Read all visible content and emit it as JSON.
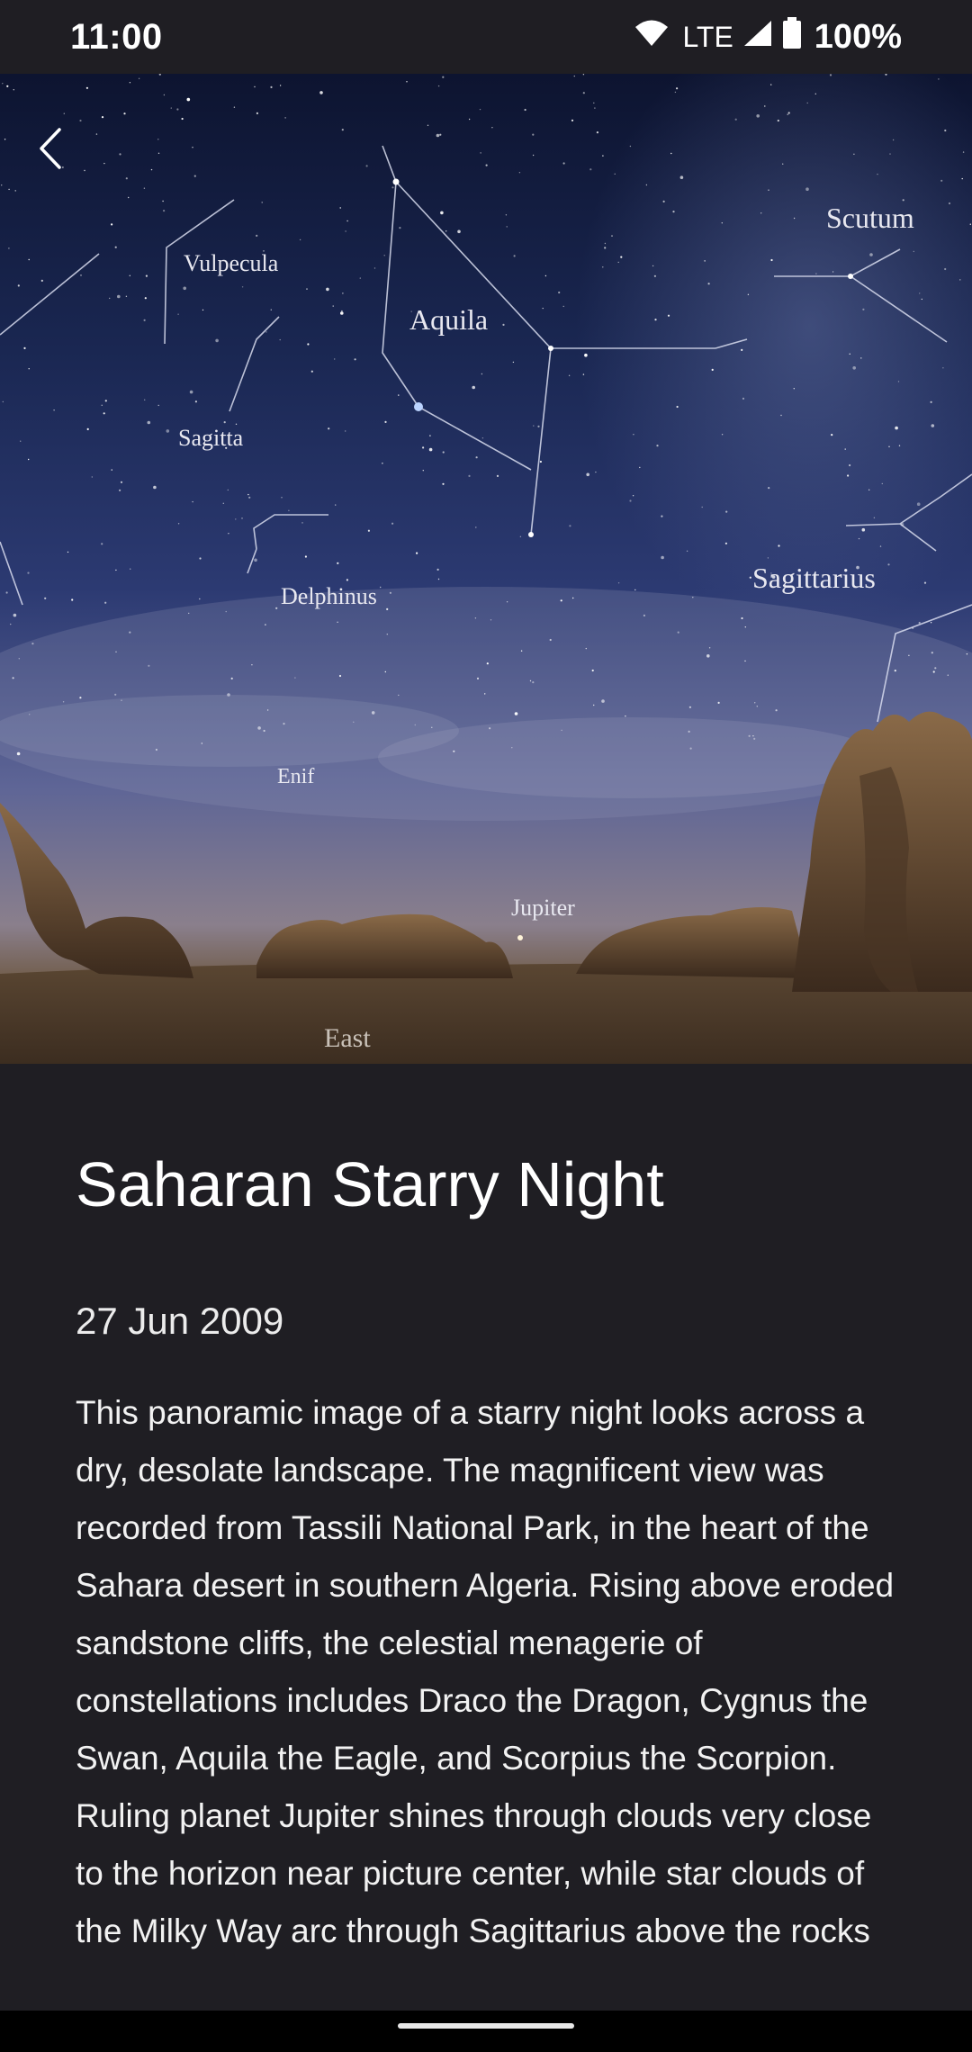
{
  "status_bar": {
    "time": "11:00",
    "network": "LTE",
    "battery": "100%"
  },
  "hero": {
    "constellation_labels": [
      "Vulpecula",
      "Aquila",
      "Scutum",
      "Sagitta",
      "Delphinus",
      "Sagittarius",
      "Enif",
      "Jupiter",
      "East"
    ]
  },
  "article": {
    "title": "Saharan Starry Night",
    "date": "27 Jun 2009",
    "description": "This panoramic image of a starry night looks across a dry, desolate landscape. The magnificent view was recorded from Tassili National Park, in the heart of the Sahara desert in southern Algeria. Rising above eroded sandstone cliffs, the celestial menagerie of constellations includes Draco the Dragon, Cygnus the Swan, Aquila the Eagle, and Scorpius the Scorpion. Ruling planet Jupiter shines through clouds very close to the horizon near picture center, while star clouds of the Milky Way arc through Sagittarius above the rocks"
  },
  "icons": {
    "back": "back-chevron-icon",
    "wifi": "wifi-icon",
    "signal": "signal-icon",
    "battery": "battery-icon"
  }
}
